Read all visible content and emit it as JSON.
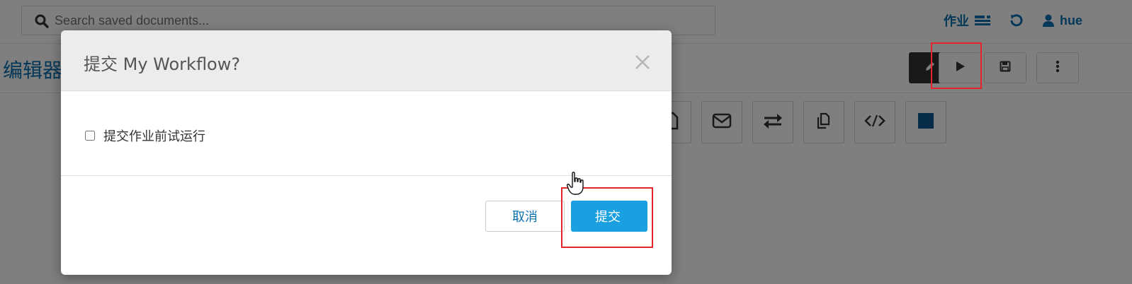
{
  "search": {
    "placeholder": "Search saved documents..."
  },
  "topnav": {
    "jobs_label": "作业",
    "user_label": "hue"
  },
  "editor": {
    "title": "编辑器"
  },
  "modal": {
    "title": "提交 My Workflow?",
    "dry_run_label": "提交作业前试运行",
    "dry_run_checked": false,
    "cancel_label": "取消",
    "submit_label": "提交"
  },
  "colors": {
    "accent": "#1a9fe0",
    "link": "#0b6fb0",
    "highlight": "#e3262e",
    "dark_button": "#333333"
  },
  "icons": [
    "search-icon",
    "jobs-list-icon",
    "history-icon",
    "user-icon",
    "pencil-icon",
    "play-icon",
    "save-icon",
    "more-vertical-icon",
    "file-icon",
    "email-icon",
    "transfer-icon",
    "copy-icon",
    "code-icon",
    "stop-icon",
    "close-icon",
    "hand-pointer-icon"
  ]
}
